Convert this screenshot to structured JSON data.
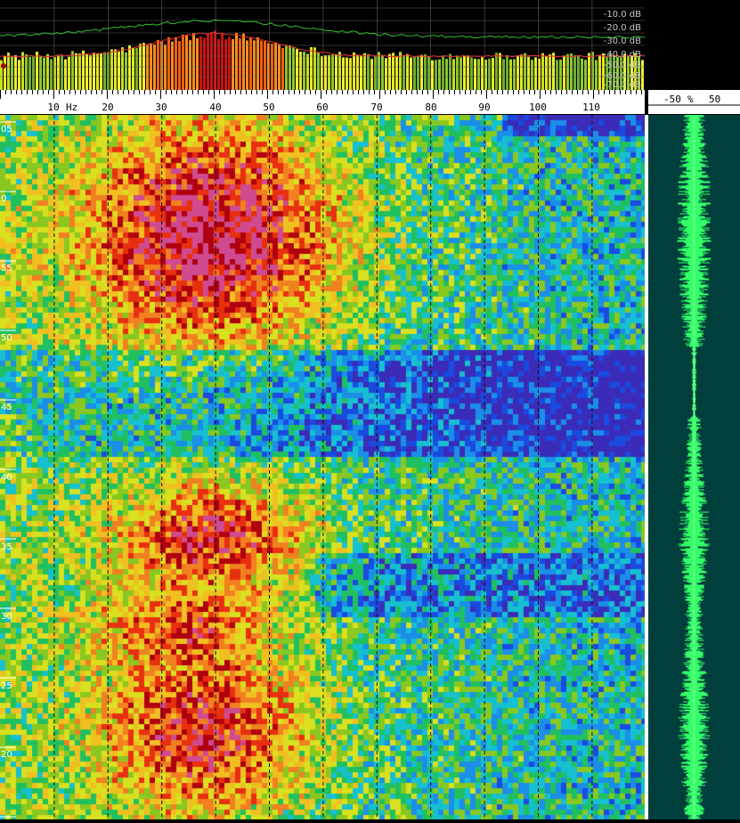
{
  "spectrum": {
    "db_labels": [
      "-10.0 dB",
      "-20.0 dB",
      "-30.0 dB",
      "-40.0 dB",
      "-50.0 dB",
      "-60.0 dB",
      "-70.0 dB"
    ]
  },
  "frequency_axis": {
    "unit": "Hz",
    "ticks": [
      "10",
      "20",
      "30",
      "40",
      "50",
      "60",
      "70",
      "80",
      "90",
      "100",
      "110"
    ]
  },
  "amplitude_axis": {
    "left": "-50",
    "mid": "%",
    "right": "50"
  },
  "time_axis": {
    "labels": [
      "05",
      "0",
      "55",
      "50",
      "45",
      "40",
      "35",
      "30",
      "25",
      "20"
    ]
  },
  "colors": {
    "waveform_bg": "#003f3c",
    "waveform_fg": "#33ff66",
    "peak_line": "#e83030",
    "avg_line": "#30c030"
  }
}
